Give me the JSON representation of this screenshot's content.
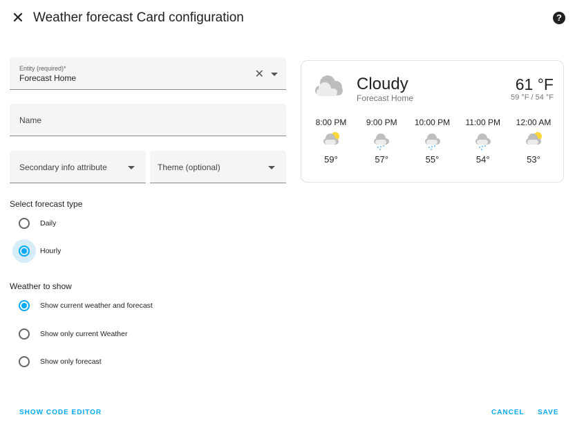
{
  "header": {
    "title": "Weather forecast Card configuration",
    "close_icon": "close-icon",
    "help_icon": "help-circle-icon"
  },
  "form": {
    "entity": {
      "label": "Entity (required)*",
      "value": "Forecast Home"
    },
    "name": {
      "label": "Name"
    },
    "secondary": {
      "label": "Secondary info attribute"
    },
    "theme": {
      "label": "Theme (optional)"
    },
    "forecast_type": {
      "title": "Select forecast type",
      "options": [
        {
          "label": "Daily",
          "checked": false
        },
        {
          "label": "Hourly",
          "checked": true
        }
      ]
    },
    "weather_show": {
      "title": "Weather to show",
      "options": [
        {
          "label": "Show current weather and forecast",
          "checked": true
        },
        {
          "label": "Show only current Weather",
          "checked": false
        },
        {
          "label": "Show only forecast",
          "checked": false
        }
      ]
    }
  },
  "preview": {
    "condition": "Cloudy",
    "entity": "Forecast Home",
    "temp": "61 °F",
    "hilo": "59 °F / 54 °F",
    "forecast": [
      {
        "time": "8:00 PM",
        "temp": "59°",
        "icon": "partly-cloudy"
      },
      {
        "time": "9:00 PM",
        "temp": "57°",
        "icon": "rainy"
      },
      {
        "time": "10:00 PM",
        "temp": "55°",
        "icon": "rainy"
      },
      {
        "time": "11:00 PM",
        "temp": "54°",
        "icon": "rainy"
      },
      {
        "time": "12:00 AM",
        "temp": "53°",
        "icon": "partly-cloudy"
      }
    ]
  },
  "footer": {
    "code_editor": "SHOW CODE EDITOR",
    "cancel": "CANCEL",
    "save": "SAVE"
  },
  "colors": {
    "accent": "#03a9f4"
  }
}
